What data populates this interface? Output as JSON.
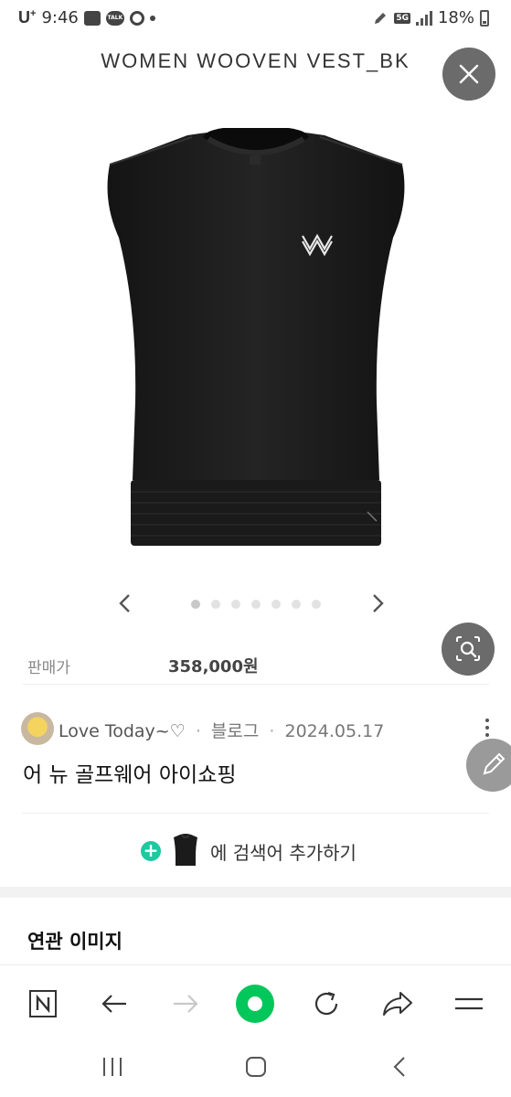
{
  "status_bar": {
    "carrier": "U",
    "carrier_sup": "+",
    "time": "9:46",
    "talk_badge": "TALK",
    "network": "5G",
    "battery": "18%"
  },
  "product": {
    "title": "WOMEN WOOVEN VEST_BK",
    "price_label": "판매가",
    "price": "358,000원",
    "carousel_page_count": 7,
    "carousel_active_index": 0,
    "image_icon": "black-sleeveless-vest-image"
  },
  "blog": {
    "author": "Love Today~♡",
    "separator": "·",
    "source": "블로그",
    "date": "2024.05.17",
    "title": "어 뉴 골프웨어 아이쇼핑"
  },
  "add_search": {
    "plus": "+",
    "text": "에 검색어 추가하기"
  },
  "related": {
    "title": "연관 이미지"
  },
  "toolbar": {
    "icons": [
      "naver-n-icon",
      "back-arrow-icon",
      "forward-arrow-icon",
      "green-home-icon",
      "refresh-icon",
      "share-icon",
      "menu-icon"
    ]
  },
  "colors": {
    "accent_green": "#03c75a",
    "fab_gray": "#6b6b6b",
    "plus_green": "#1ec8a0"
  }
}
